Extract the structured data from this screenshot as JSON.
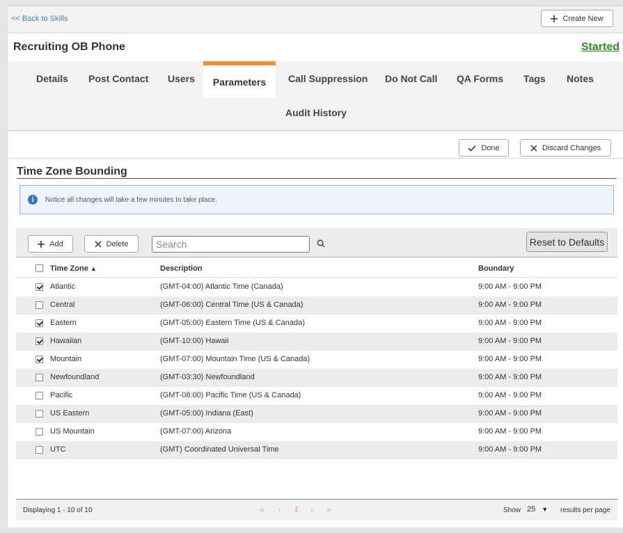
{
  "topbar": {
    "back_label": "<< Back to Skills",
    "create_label": "Create New"
  },
  "header": {
    "title": "Recruiting OB Phone",
    "status": "Started",
    "status_color": "#2e8b1f"
  },
  "tabs": {
    "row1": [
      "Details",
      "Post Contact",
      "Users",
      "Parameters",
      "Call Suppression",
      "Do Not Call",
      "QA Forms",
      "Tags",
      "Notes"
    ],
    "row2": [
      "Audit History"
    ],
    "active": "Parameters",
    "accent_color": "#f58d39"
  },
  "actions": {
    "done_label": "Done",
    "discard_label": "Discard Changes"
  },
  "section": {
    "title": "Time Zone Bounding",
    "notice": "Notice all changes will take a few minutes to take place.",
    "notice_icon": "info-icon"
  },
  "toolbar": {
    "add_label": "Add",
    "delete_label": "Delete",
    "search_placeholder": "Search",
    "reset_label": "Reset to Defaults"
  },
  "table": {
    "columns": [
      "Time Zone",
      "Description",
      "Boundary"
    ],
    "sort_column": "Time Zone",
    "sort_direction": "ascending",
    "rows": [
      {
        "zone": "Atlantic",
        "description": "(GMT-04:00) Atlantic Time (Canada)",
        "boundary": "9:00 AM - 9:00 PM",
        "checked": true
      },
      {
        "zone": "Central",
        "description": "(GMT-06:00) Central Time (US & Canada)",
        "boundary": "9:00 AM - 9:00 PM",
        "checked": false
      },
      {
        "zone": "Eastern",
        "description": "(GMT-05:00) Eastern Time (US & Canada)",
        "boundary": "9:00 AM - 9:00 PM",
        "checked": true
      },
      {
        "zone": "Hawaiian",
        "description": "(GMT-10:00) Hawaii",
        "boundary": "9:00 AM - 9:00 PM",
        "checked": true
      },
      {
        "zone": "Mountain",
        "description": "(GMT-07:00) Mountain Time (US & Canada)",
        "boundary": "9:00 AM - 9:00 PM",
        "checked": true
      },
      {
        "zone": "Newfoundland",
        "description": "(GMT-03:30) Newfoundland",
        "boundary": "9:00 AM - 9:00 PM",
        "checked": false
      },
      {
        "zone": "Pacific",
        "description": "(GMT-08:00) Pacific Time (US & Canada)",
        "boundary": "9:00 AM - 9:00 PM",
        "checked": false
      },
      {
        "zone": "US Eastern",
        "description": "(GMT-05:00) Indiana (East)",
        "boundary": "9:00 AM - 9:00 PM",
        "checked": false
      },
      {
        "zone": "US Mountain",
        "description": "(GMT-07:00) Arizona",
        "boundary": "9:00 AM - 9:00 PM",
        "checked": false
      },
      {
        "zone": "UTC",
        "description": "(GMT) Coordinated Universal Time",
        "boundary": "9:00 AM - 9:00 PM",
        "checked": false
      }
    ]
  },
  "pager": {
    "info": "Displaying 1 - 10 of 10",
    "current_page": "1",
    "show_label": "Show",
    "per_page": "25",
    "results_label": "results per page"
  }
}
